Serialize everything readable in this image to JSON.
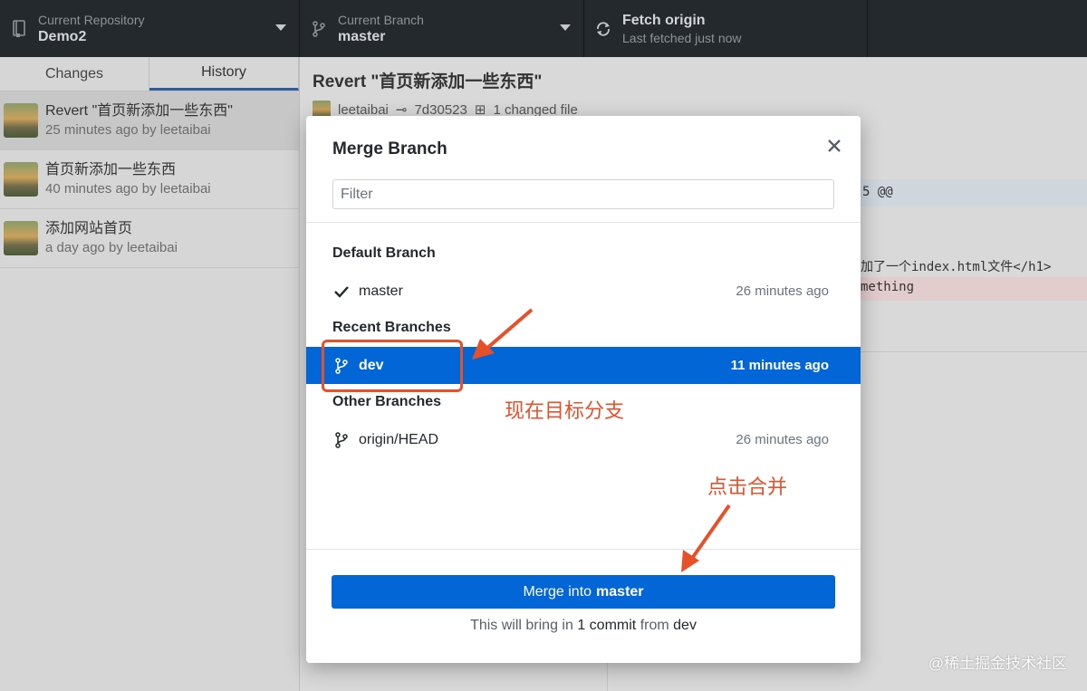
{
  "toolbar": {
    "repo": {
      "label": "Current Repository",
      "value": "Demo2",
      "icon": "repo-icon"
    },
    "branch": {
      "label": "Current Branch",
      "value": "master",
      "icon": "branch-icon"
    },
    "fetch": {
      "label": "Fetch origin",
      "sub": "Last fetched just now",
      "icon": "sync-icon"
    }
  },
  "sidebar": {
    "tabs": [
      {
        "label": "Changes",
        "active": false
      },
      {
        "label": "History",
        "active": true
      }
    ],
    "commits": [
      {
        "title": "Revert \"首页新添加一些东西\"",
        "meta": "25 minutes ago by leetaibai"
      },
      {
        "title": "首页新添加一些东西",
        "meta": "40 minutes ago by leetaibai"
      },
      {
        "title": "添加网站首页",
        "meta": "a day ago by leetaibai"
      }
    ]
  },
  "main": {
    "title": "Revert \"首页新添加一些东西\"",
    "author": "leetaibai",
    "sha": "7d30523",
    "changed": "1 changed file",
    "diff_hunk_tail": "5 @@",
    "diff_line1": "加了一个index.html文件</h1>",
    "diff_line2": "mething"
  },
  "modal": {
    "title": "Merge Branch",
    "filter_placeholder": "Filter",
    "groups": {
      "default": "Default Branch",
      "recent": "Recent Branches",
      "other": "Other Branches"
    },
    "branches": {
      "master": {
        "name": "master",
        "time": "26 minutes ago"
      },
      "dev": {
        "name": "dev",
        "time": "11 minutes ago"
      },
      "origin_head": {
        "name": "origin/HEAD",
        "time": "26 minutes ago"
      }
    },
    "merge_button": {
      "prefix": "Merge into",
      "target": "master"
    },
    "note": {
      "pre": "This will bring in",
      "count": "1 commit",
      "mid": "from",
      "source": "dev"
    }
  },
  "annotations": {
    "target_branch": "现在目标分支",
    "click_merge": "点击合并",
    "color": "#e8502a"
  },
  "watermark": "@稀土掘金技术社区",
  "colors": {
    "toolbar_bg": "#24292e",
    "accent_blue": "#0366d6",
    "annotation": "#e8502a"
  }
}
